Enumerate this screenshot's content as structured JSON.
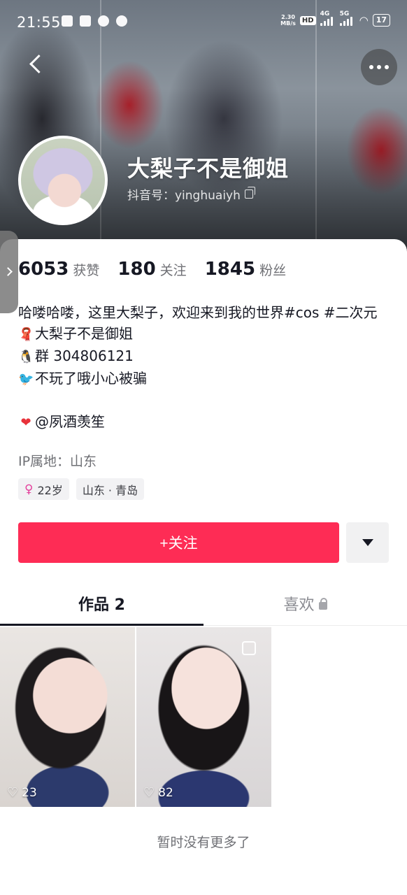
{
  "status_bar": {
    "time": "21:55",
    "net_speed_value": "2.30",
    "net_speed_unit": "MB/s",
    "hd_label": "HD",
    "signal_1_label": "4G",
    "signal_2_label": "5G",
    "battery": "17",
    "app_icons": [
      "message-icon",
      "cat-app-icon",
      "tiktok-icon",
      "wechat-icon"
    ]
  },
  "profile": {
    "name": "大梨子不是御姐",
    "douyin_id": "抖音号：yinghuaiyh"
  },
  "stats": [
    {
      "value": "6053",
      "label": "获赞"
    },
    {
      "value": "180",
      "label": "关注"
    },
    {
      "value": "1845",
      "label": "粉丝"
    }
  ],
  "bio": {
    "line1": "哈喽哈喽，这里大梨子，欢迎来到我的世界#cos #二次元",
    "line2": "大梨子不是御姐",
    "line3": "群 304806121",
    "line4": "不玩了哦小心被骗",
    "line5": "@夙酒羡笙",
    "emoji_scarf": "🧣",
    "emoji_penguin": "🐧",
    "emoji_bird": "🐦",
    "emoji_heart": "❤"
  },
  "ip_location": "IP属地：山东",
  "tags": {
    "gender_symbol": "♀",
    "age": "22岁",
    "location": "山东 · 青岛"
  },
  "actions": {
    "follow_label": "+关注"
  },
  "tabs": {
    "works": "作品 2",
    "likes": "喜欢"
  },
  "posts": [
    {
      "likes": "23"
    },
    {
      "likes": "82"
    }
  ],
  "footer": {
    "end_text": "暂时没有更多了"
  },
  "colors": {
    "follow_button": "#fe2c55",
    "primary_text": "#161823",
    "secondary_text": "#6f7075",
    "female_tag": "#e4409c"
  }
}
